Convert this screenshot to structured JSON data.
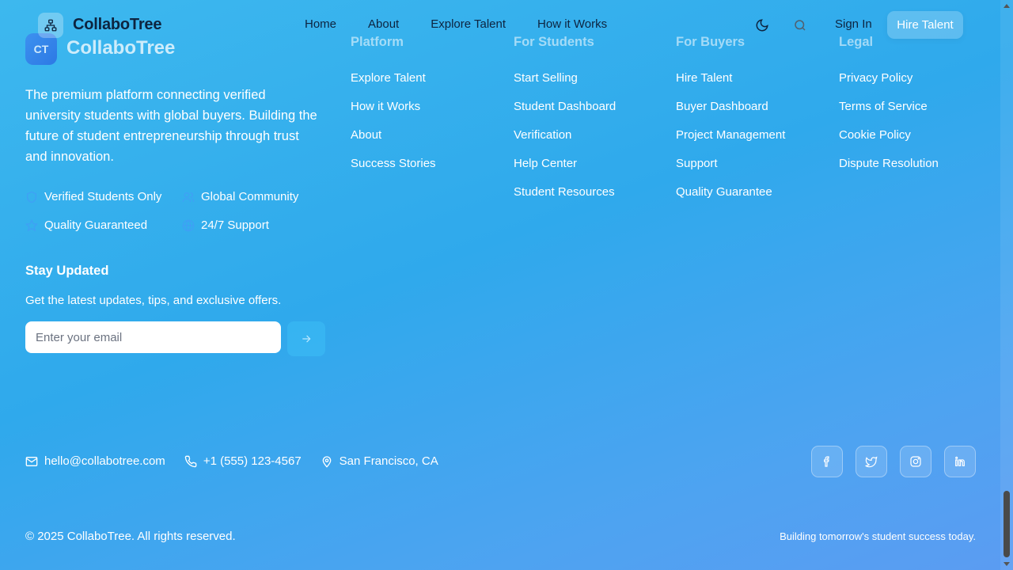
{
  "header": {
    "brand": "CollaboTree",
    "nav": [
      "Home",
      "About",
      "Explore Talent",
      "How it Works"
    ],
    "sign_in": "Sign In",
    "hire_button": "Hire Talent",
    "theme_icon": "moon-icon",
    "search_icon": "search-icon"
  },
  "footer": {
    "logo_initials": "CT",
    "brand": "CollaboTree",
    "description": "The premium platform connecting verified university students with global buyers. Building the future of student entrepreneurship through trust and innovation.",
    "features": [
      {
        "label": "Verified Students Only",
        "icon": "shield-icon"
      },
      {
        "label": "Global Community",
        "icon": "users-icon"
      },
      {
        "label": "Quality Guaranteed",
        "icon": "star-icon"
      },
      {
        "label": "24/7 Support",
        "icon": "globe-icon"
      }
    ],
    "newsletter": {
      "title": "Stay Updated",
      "description": "Get the latest updates, tips, and exclusive offers.",
      "placeholder": "Enter your email"
    },
    "columns": [
      {
        "title": "Platform",
        "links": [
          "Explore Talent",
          "How it Works",
          "About",
          "Success Stories"
        ]
      },
      {
        "title": "For Students",
        "links": [
          "Start Selling",
          "Student Dashboard",
          "Verification",
          "Help Center",
          "Student Resources"
        ]
      },
      {
        "title": "For Buyers",
        "links": [
          "Hire Talent",
          "Buyer Dashboard",
          "Project Management",
          "Support",
          "Quality Guarantee"
        ]
      },
      {
        "title": "Legal",
        "links": [
          "Privacy Policy",
          "Terms of Service",
          "Cookie Policy",
          "Dispute Resolution"
        ]
      }
    ],
    "contact": {
      "email": "hello@collabotree.com",
      "phone": "+1 (555) 123-4567",
      "location": "San Francisco, CA"
    },
    "socials": [
      "facebook-icon",
      "twitter-icon",
      "instagram-icon",
      "linkedin-icon"
    ],
    "copyright": "© 2025 CollaboTree. All rights reserved.",
    "tagline": "Building tomorrow's student success today."
  }
}
